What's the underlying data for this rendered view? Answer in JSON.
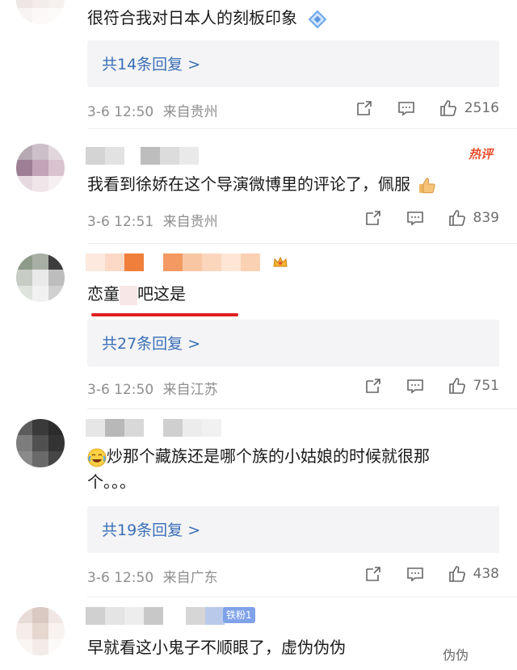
{
  "comments": [
    {
      "text": "很符合我对日本人的刻板印象",
      "reply_label": "共14条回复 >",
      "date": "3-6 12:50",
      "location": "来自贵州",
      "likes": "2516"
    },
    {
      "hot_tag": "热评",
      "text": "我看到徐娇在这个导演微博里的评论了，佩服",
      "date": "3-6 12:51",
      "location": "来自贵州",
      "likes": "839"
    },
    {
      "text_before": "恋童",
      "text_after": "吧这是",
      "reply_label": "共27条回复 >",
      "date": "3-6 12:50",
      "location": "来自江苏",
      "likes": "751"
    },
    {
      "text_line1": "炒那个藏族还是哪个族的小姑娘的时候就很那",
      "text_line2": "个。。。",
      "reply_label": "共19条回复 >",
      "date": "3-6 12:50",
      "location": "来自广东",
      "likes": "438"
    },
    {
      "fan_badge": "铁粉1",
      "text": "早就看这小鬼子不顺眼了，虚伪伪伪",
      "text_tail": "伪伪"
    }
  ],
  "icons": {
    "repost": "share-icon",
    "comment": "comment-icon",
    "like": "thumbs-up-icon",
    "diamond": "diamond-badge-icon",
    "crown": "crown-badge-icon",
    "thumb_emoji": "thumbs-up-emoji",
    "laugh_emoji": "laugh-cry-emoji"
  },
  "colors": {
    "link": "#3b6fb6",
    "hot": "#e8502f",
    "underline": "#e02020",
    "meta": "#8e8e8e"
  }
}
